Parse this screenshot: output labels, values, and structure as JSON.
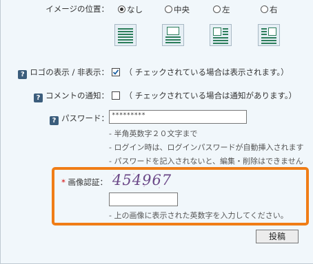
{
  "image_position": {
    "label": "イメージの位置：",
    "options": [
      {
        "label": "なし",
        "checked": true
      },
      {
        "label": "中央",
        "checked": false
      },
      {
        "label": "左",
        "checked": false
      },
      {
        "label": "右",
        "checked": false
      }
    ]
  },
  "logo_display": {
    "help": "?",
    "label": "ロゴの表示 / 非表示：",
    "checked": true,
    "note": "（ チェックされている場合は表示されます。）"
  },
  "comment_notify": {
    "help": "?",
    "label": "コメントの通知：",
    "checked": false,
    "note": "（ チェックされている場合は通知があります。）"
  },
  "password": {
    "help": "?",
    "label": "パスワード：",
    "value": "*********",
    "hints": [
      "- 半角英数字２０文字まで",
      "- ログイン時は、ログインパスワードが自動挿入されます",
      "- パスワードを記入されないと、編集・削除はできません"
    ]
  },
  "captcha": {
    "required_mark": "*",
    "label": "画像認証：",
    "code": "454967",
    "input_value": "",
    "hint": "- 上の画像に表示された英数字を入力してください。"
  },
  "submit_label": "投稿",
  "colors": {
    "highlight": "#f07d16",
    "help_icon": "#3b5d7c",
    "required": "#d40000"
  }
}
